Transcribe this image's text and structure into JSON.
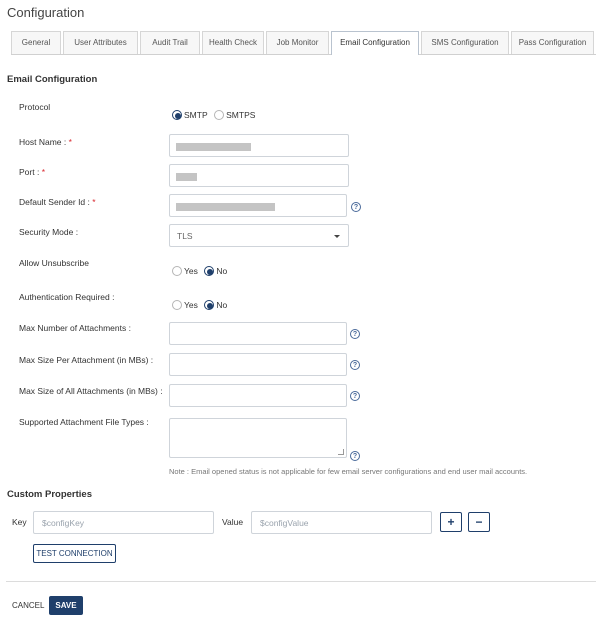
{
  "page": {
    "title": "Configuration"
  },
  "tabs": [
    {
      "label": "General"
    },
    {
      "label": "User Attributes"
    },
    {
      "label": "Audit Trail"
    },
    {
      "label": "Health Check"
    },
    {
      "label": "Job Monitor"
    },
    {
      "label": "Email Configuration",
      "active": true
    },
    {
      "label": "SMS Configuration"
    },
    {
      "label": "Pass Configuration"
    }
  ],
  "email": {
    "section_title": "Email Configuration",
    "protocol": {
      "label": "Protocol",
      "options": [
        "SMTP",
        "SMTPS"
      ],
      "selected": "SMTP"
    },
    "host_name": {
      "label": "Host Name :",
      "required_mark": "*"
    },
    "port": {
      "label": "Port :",
      "required_mark": "*"
    },
    "default_sender": {
      "label": "Default Sender Id :",
      "required_mark": "*"
    },
    "security_mode": {
      "label": "Security Mode :",
      "value": "TLS"
    },
    "allow_unsubscribe": {
      "label": "Allow Unsubscribe",
      "options": [
        "Yes",
        "No"
      ],
      "selected": "No"
    },
    "auth_required": {
      "label": "Authentication Required :",
      "options": [
        "Yes",
        "No"
      ],
      "selected": "No"
    },
    "max_attachments": {
      "label": "Max Number of Attachments :"
    },
    "max_size_per": {
      "label": "Max Size Per Attachment (in MBs) :"
    },
    "max_size_all": {
      "label": "Max Size of All Attachments (in MBs) :"
    },
    "file_types": {
      "label": "Supported Attachment File Types :"
    },
    "help_glyph": "?",
    "note": "Note : Email opened status is not applicable for few email server configurations and end user mail accounts."
  },
  "custom_properties": {
    "title": "Custom Properties",
    "key_label": "Key",
    "key_placeholder": "$configKey",
    "value_label": "Value",
    "value_placeholder": "$configValue",
    "add_glyph": "+",
    "remove_glyph": "−",
    "test_button": "TEST CONNECTION"
  },
  "footer": {
    "cancel": "CANCEL",
    "save": "SAVE"
  },
  "colors": {
    "primary": "#1f3f6b",
    "required": "#d9272e",
    "border": "#cfd4da"
  }
}
